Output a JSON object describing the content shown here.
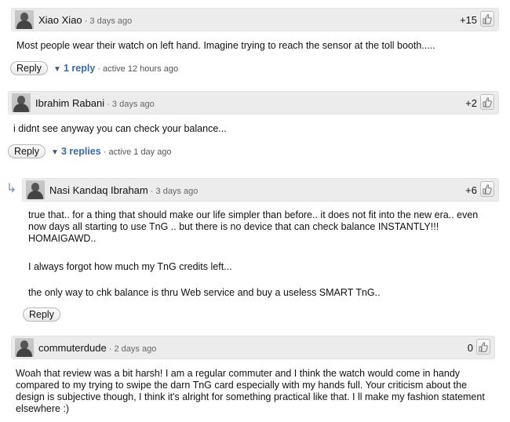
{
  "comments": [
    {
      "author": "Xiao Xiao",
      "time": " · 3 days ago",
      "score": "+15",
      "body": [
        "Most people wear their watch on left hand. Imagine trying to reach the sensor at the toll booth....."
      ],
      "reply_label": "Reply",
      "thread": {
        "arrow": "▼",
        "count": "1 reply",
        "activity": " · active 12 hours ago"
      }
    },
    {
      "author": "Ibrahim Rabani",
      "time": " · 3 days ago",
      "score": "+2",
      "body": [
        "i didnt see anyway you can check your balance..."
      ],
      "reply_label": "Reply",
      "thread": {
        "arrow": "▼",
        "count": "3 replies",
        "activity": " · active 1 day ago"
      }
    },
    {
      "author": "Nasi Kandaq Ibraham",
      "time": " · 3 days ago",
      "score": "+6",
      "reply_indicator": "↳",
      "body": [
        "true that.. for a thing that should make our life simpler than before.. it does not fit into the new era.. even now days all starting to use TnG .. but there is no device that can check balance INSTANTLY!!! HOMAIGAWD..",
        "I always forgot how much my TnG credits left...",
        "the only way to chk balance is thru Web service and buy a useless SMART TnG.."
      ],
      "reply_label": "Reply"
    },
    {
      "author": "commuterdude",
      "time": " · 2 days ago",
      "score": "0",
      "body": [
        "Woah that review was a bit harsh! I am a regular commuter and I think the watch would come in handy compared to my trying to swipe the darn TnG card especially with my hands full. Your criticism about the design is subjective though, I think it's alright for something practical like that. I ll make my fashion statement elsewhere :)"
      ]
    }
  ]
}
